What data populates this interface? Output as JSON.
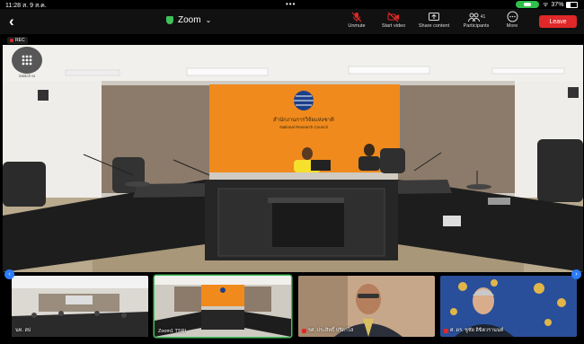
{
  "status_bar": {
    "time": "11:28",
    "date": "ส. 9 ส.ค.",
    "dots": "•••",
    "wifi_glyph": "ᯤ",
    "battery_text": "37%"
  },
  "toolbar": {
    "back_glyph": "‹",
    "meeting_title": "Zoom",
    "caret_glyph": "⌄",
    "unmute_label": "Unmute",
    "start_video_label": "Start video",
    "share_label": "Share content",
    "participants_label": "Participants",
    "participants_count": "41",
    "more_label": "More",
    "leave_label": "Leave"
  },
  "recording": {
    "label": "REC"
  },
  "switch": {
    "label": "Switch to"
  },
  "scene": {
    "banner_line1": "สำนักงานการวิจัยแห่งชาติ",
    "banner_line2": "National Research Council"
  },
  "thumbnails": [
    {
      "name": "นท. สป"
    },
    {
      "name": "Zoom1 TSRI"
    },
    {
      "name": "รศ. ประสิทธิ์ ปรีดาโส"
    },
    {
      "name": "ศ. ดร. ชูชัย ลิขิตวรานนท์"
    }
  ],
  "page_arrows": {
    "left_glyph": "‹",
    "right_glyph": "›"
  },
  "colors": {
    "leave": "#e02828",
    "active_border": "#3ec15a",
    "orange_wall": "#f08a1c",
    "page_arrow": "#2b7cff"
  }
}
